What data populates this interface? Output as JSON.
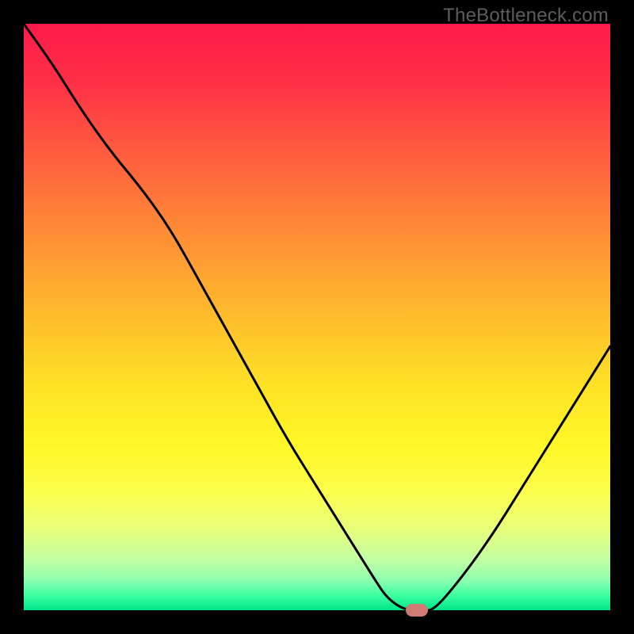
{
  "watermark": "TheBottleneck.com",
  "colors": {
    "frame_bg": "#000000",
    "marker": "#cf7a72",
    "curve": "#000000"
  },
  "gradient_stops": [
    {
      "offset": 0.0,
      "color": "#ff1a4b"
    },
    {
      "offset": 0.1,
      "color": "#ff3045"
    },
    {
      "offset": 0.2,
      "color": "#ff5540"
    },
    {
      "offset": 0.35,
      "color": "#ff8a36"
    },
    {
      "offset": 0.5,
      "color": "#ffbd2c"
    },
    {
      "offset": 0.62,
      "color": "#ffe326"
    },
    {
      "offset": 0.72,
      "color": "#fff727"
    },
    {
      "offset": 0.8,
      "color": "#fbff4d"
    },
    {
      "offset": 0.86,
      "color": "#e8ff7a"
    },
    {
      "offset": 0.91,
      "color": "#c7ffa0"
    },
    {
      "offset": 0.95,
      "color": "#8affb0"
    },
    {
      "offset": 0.975,
      "color": "#3bffa0"
    },
    {
      "offset": 1.0,
      "color": "#00e58a"
    }
  ],
  "chart_data": {
    "type": "line",
    "title": "",
    "xlabel": "",
    "ylabel": "",
    "xlim": [
      0,
      100
    ],
    "ylim": [
      0,
      100
    ],
    "x": [
      0,
      5,
      10,
      15,
      20,
      25,
      30,
      35,
      40,
      45,
      50,
      55,
      60,
      62,
      65,
      68,
      70,
      75,
      80,
      85,
      90,
      95,
      100
    ],
    "y": [
      100,
      93,
      85,
      78,
      72,
      65,
      56,
      47,
      38,
      29,
      21,
      13,
      5,
      2,
      0,
      0,
      0,
      6,
      13,
      21,
      29,
      37,
      45
    ],
    "marker": {
      "x": 67,
      "y": 0
    },
    "note": "values estimated from pixel positions; axes unlabeled in source"
  }
}
